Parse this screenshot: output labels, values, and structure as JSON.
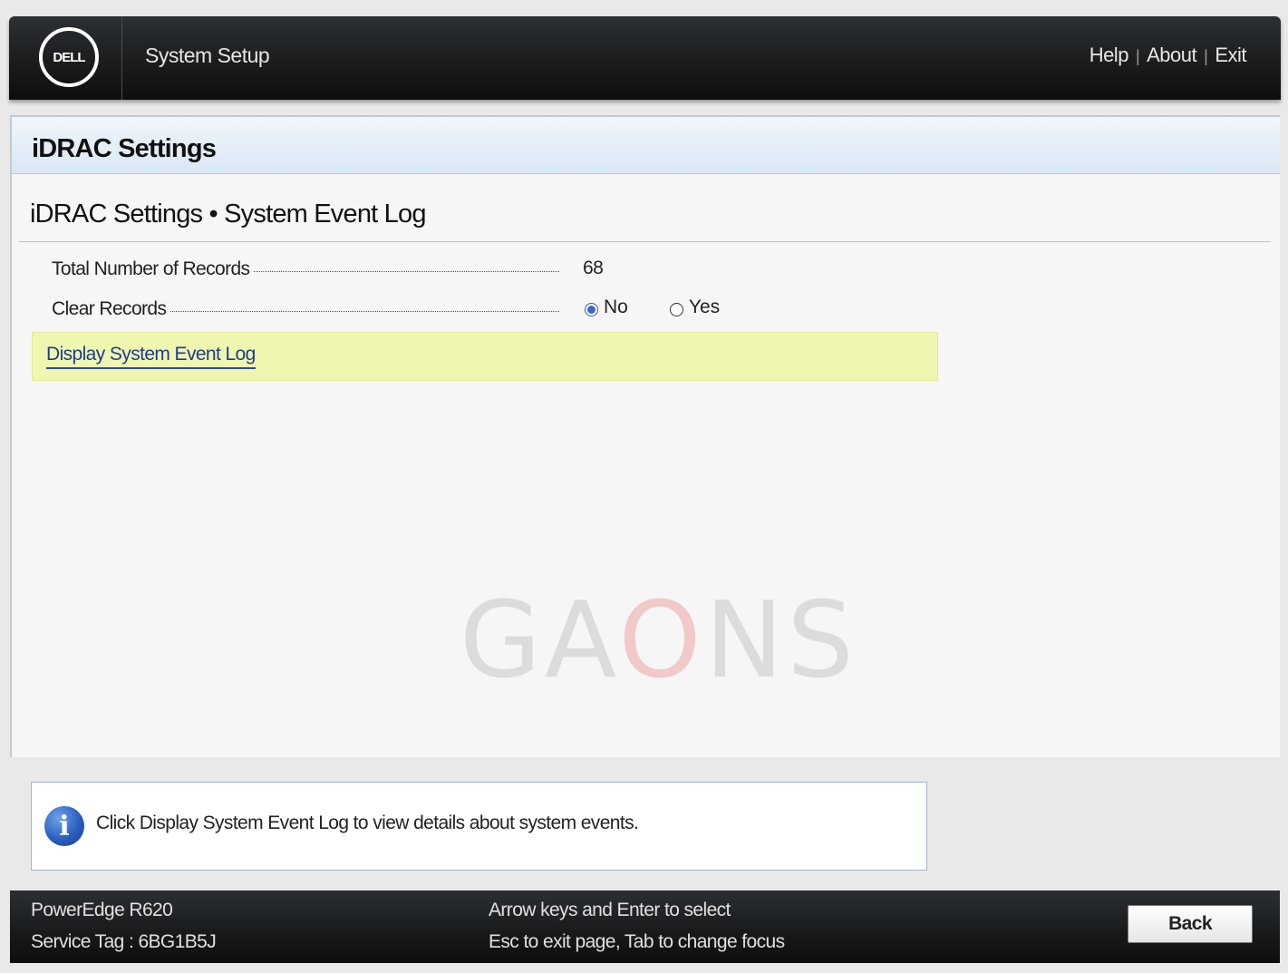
{
  "header": {
    "logo_text": "DELL",
    "app_title": "System Setup",
    "links": [
      "Help",
      "About",
      "Exit"
    ]
  },
  "panel": {
    "section_title": "iDRAC Settings",
    "page_title": "iDRAC Settings • System Event Log",
    "total_records_label": "Total Number of Records",
    "total_records_value": "68",
    "clear_records_label": "Clear Records",
    "clear_records_options": [
      {
        "label": "No",
        "selected": true
      },
      {
        "label": "Yes",
        "selected": false
      }
    ],
    "display_link": "Display System Event Log",
    "watermark": "GAONS"
  },
  "info": {
    "icon": "info-icon",
    "text": "Click Display System Event Log to view details about system events."
  },
  "footer": {
    "model": "PowerEdge R620",
    "service_tag": "Service Tag : 6BG1B5J",
    "hint1": "Arrow keys and Enter to select",
    "hint2": "Esc to exit page, Tab to change focus",
    "back_label": "Back"
  }
}
